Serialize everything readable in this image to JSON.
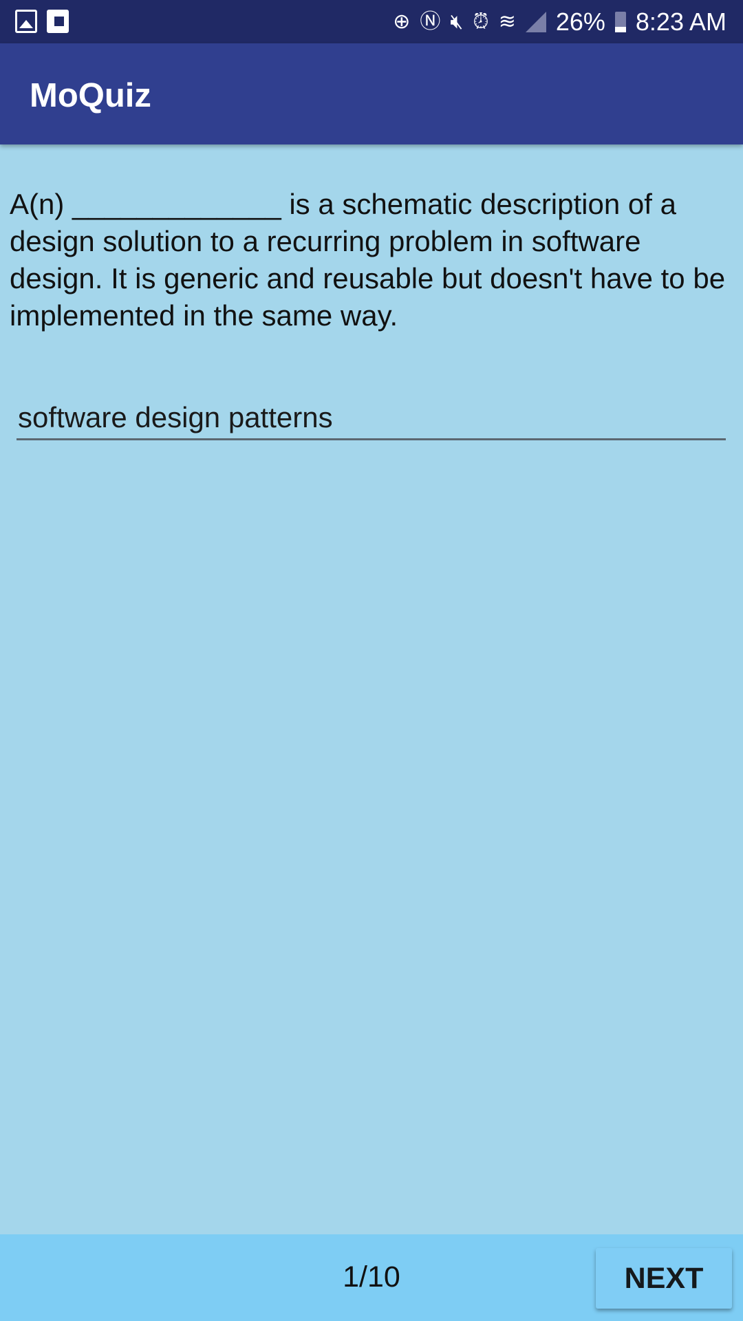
{
  "status_bar": {
    "battery": "26%",
    "time": "8:23 AM",
    "icons": [
      "gallery-icon",
      "flipboard-icon",
      "data-saver-icon",
      "nfc-icon",
      "mute-icon",
      "alarm-icon",
      "wifi-icon",
      "signal-icon",
      "battery-icon"
    ]
  },
  "app_bar": {
    "title": "MoQuiz"
  },
  "question": {
    "text": "A(n) _____________ is a schematic description of a design solution to a recurring problem in software design. It is generic and reusable but doesn't have to be implemented in the same way."
  },
  "answer": {
    "value": "software design patterns"
  },
  "footer": {
    "counter": "1/10",
    "next_label": "NEXT"
  },
  "colors": {
    "status": "#202965",
    "appbar": "#303f8f",
    "content": "#a4d6eb",
    "footer": "#7ecdf4"
  }
}
